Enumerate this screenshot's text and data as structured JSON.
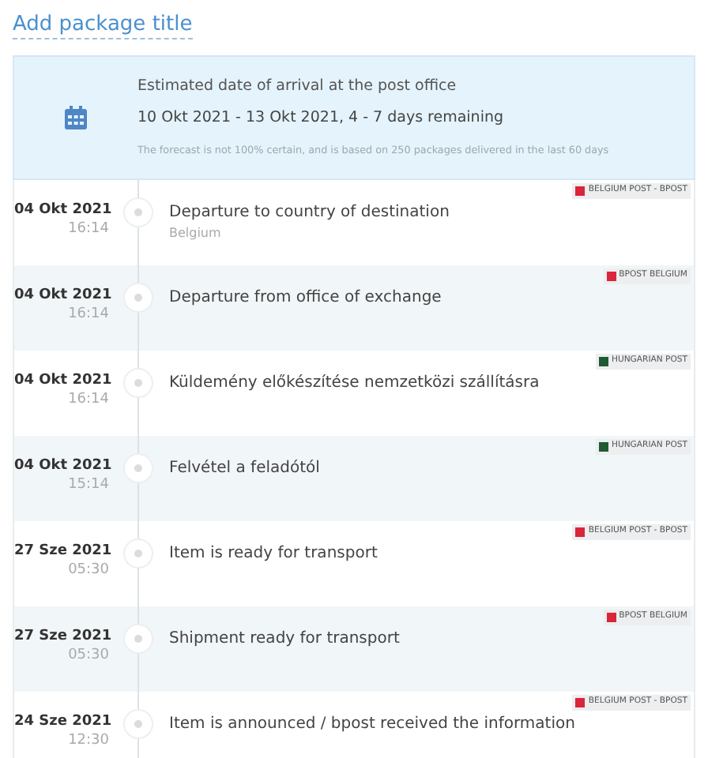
{
  "title_link": "Add package title",
  "estimate": {
    "heading": "Estimated date of arrival at the post office",
    "range": "10 Okt 2021 - 13 Okt 2021, 4 - 7 days remaining",
    "note": "The forecast is not 100% certain, and is based on 250 packages delivered in the last 60 days"
  },
  "events": [
    {
      "date": "04 Okt 2021",
      "time": "16:14",
      "text": "Departure to country of destination",
      "detail": "Belgium",
      "carrier": "BELGIUM POST - BPOST",
      "color": "#d9263a"
    },
    {
      "date": "04 Okt 2021",
      "time": "16:14",
      "text": "Departure from office of exchange",
      "carrier": "BPOST BELGIUM",
      "color": "#d9263a"
    },
    {
      "date": "04 Okt 2021",
      "time": "16:14",
      "text": "Küldemény előkészítése nemzetközi szállításra",
      "carrier": "HUNGARIAN POST",
      "color": "#1f5a32"
    },
    {
      "date": "04 Okt 2021",
      "time": "15:14",
      "text": "Felvétel a feladótól",
      "carrier": "HUNGARIAN POST",
      "color": "#1f5a32"
    },
    {
      "date": "27 Sze 2021",
      "time": "05:30",
      "text": "Item is ready for transport",
      "carrier": "BELGIUM POST - BPOST",
      "color": "#d9263a"
    },
    {
      "date": "27 Sze 2021",
      "time": "05:30",
      "text": "Shipment ready for transport",
      "carrier": "BPOST BELGIUM",
      "color": "#d9263a"
    },
    {
      "date": "24 Sze 2021",
      "time": "12:30",
      "text": "Item is announced / bpost received the information",
      "carrier": "BELGIUM POST - BPOST",
      "color": "#d9263a"
    }
  ]
}
